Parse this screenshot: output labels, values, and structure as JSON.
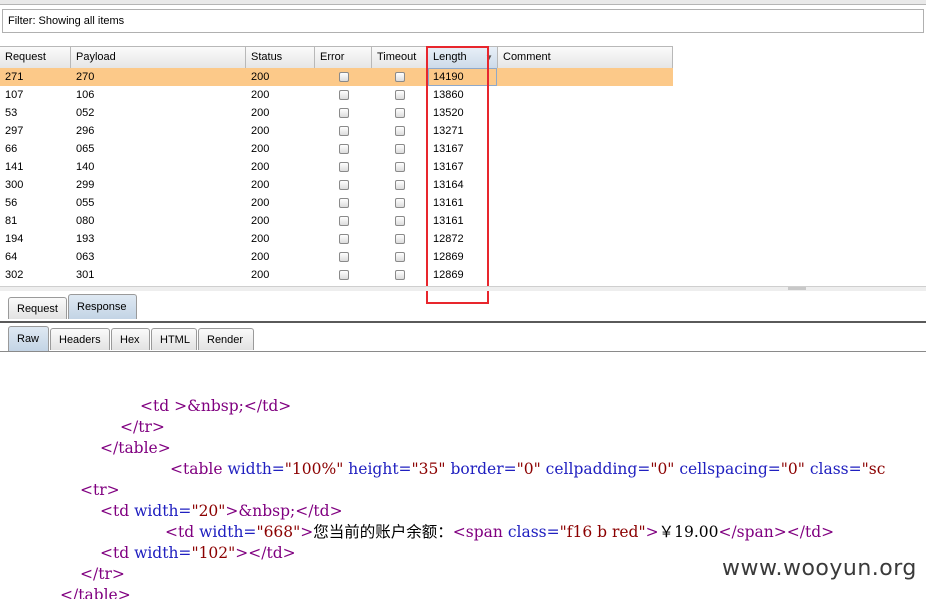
{
  "filter": {
    "text": "Filter:  Showing all items"
  },
  "table": {
    "headers": [
      "Request",
      "Payload",
      "Status",
      "Error",
      "Timeout",
      "Length",
      "Comment"
    ],
    "rows": [
      {
        "request": "271",
        "payload": "270",
        "status": "200",
        "length": "14190"
      },
      {
        "request": "107",
        "payload": "106",
        "status": "200",
        "length": "13860"
      },
      {
        "request": "53",
        "payload": "052",
        "status": "200",
        "length": "13520"
      },
      {
        "request": "297",
        "payload": "296",
        "status": "200",
        "length": "13271"
      },
      {
        "request": "66",
        "payload": "065",
        "status": "200",
        "length": "13167"
      },
      {
        "request": "141",
        "payload": "140",
        "status": "200",
        "length": "13167"
      },
      {
        "request": "300",
        "payload": "299",
        "status": "200",
        "length": "13164"
      },
      {
        "request": "56",
        "payload": "055",
        "status": "200",
        "length": "13161"
      },
      {
        "request": "81",
        "payload": "080",
        "status": "200",
        "length": "13161"
      },
      {
        "request": "194",
        "payload": "193",
        "status": "200",
        "length": "12872"
      },
      {
        "request": "64",
        "payload": "063",
        "status": "200",
        "length": "12869"
      },
      {
        "request": "302",
        "payload": "301",
        "status": "200",
        "length": "12869"
      }
    ],
    "selected_color": "#fcc989"
  },
  "tabs_main": [
    "Request",
    "Response"
  ],
  "tabs_view": [
    "Raw",
    "Headers",
    "Hex",
    "HTML",
    "Render"
  ],
  "code": {
    "l1a": "<td ",
    "l1b": ">&nbsp;",
    "l1c": "</td>",
    "l2": "</tr>",
    "l3": "</table>",
    "l4a": "<table ",
    "l4b": "width=",
    "l4c": "\"100%\"",
    "l4d": " height=",
    "l4e": "\"35\"",
    "l4f": " border=",
    "l4g": "\"0\"",
    "l4h": " cellpadding=",
    "l4i": "\"0\"",
    "l4j": " cellspacing=",
    "l4k": "\"0\"",
    "l4l": " class=",
    "l4m": "\"sc",
    "l5": "<tr>",
    "l6a": "<td ",
    "l6b": "width=",
    "l6c": "\"20\"",
    "l6d": ">&nbsp;",
    "l6e": "</td>",
    "l7a": "<td ",
    "l7b": "width=",
    "l7c": "\"668\"",
    "l7d": ">",
    "l7e": "您当前的账户余额：",
    "l7f": "<span ",
    "l7g": "class=",
    "l7h": "\"f16 b red\"",
    "l7i": ">",
    "l7j": "￥19.00",
    "l7k": "</span></td>",
    "l8a": "<td ",
    "l8b": "width=",
    "l8c": "\"102\"",
    "l8d": "></td>",
    "l9": "</tr>",
    "l10": "</table>"
  },
  "watermark": "www.wooyun.org"
}
